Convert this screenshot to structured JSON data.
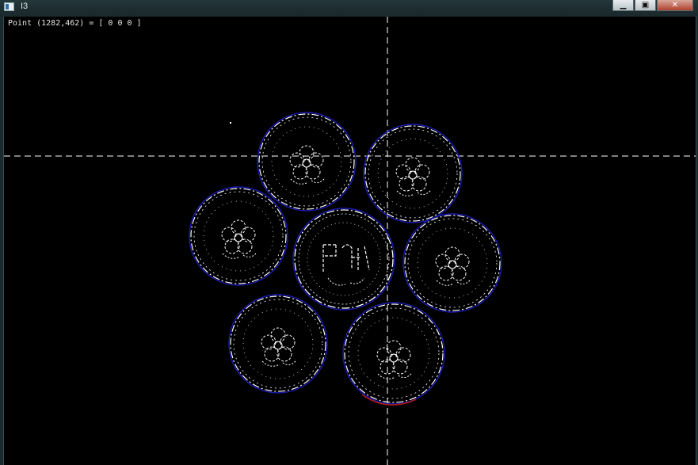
{
  "window": {
    "title": "I3",
    "minimize_glyph": "▁",
    "maximize_glyph": "▣",
    "close_glyph": "✕"
  },
  "image": {
    "status_text": "Point (1282,462) = [ 0 0 0 ]",
    "content": "edge-detected image of seven coins",
    "colors": {
      "background": "#000000",
      "edges": "#ffffff",
      "circle_outline": "#1a1ab4",
      "crosshair": "#ffffff"
    }
  }
}
